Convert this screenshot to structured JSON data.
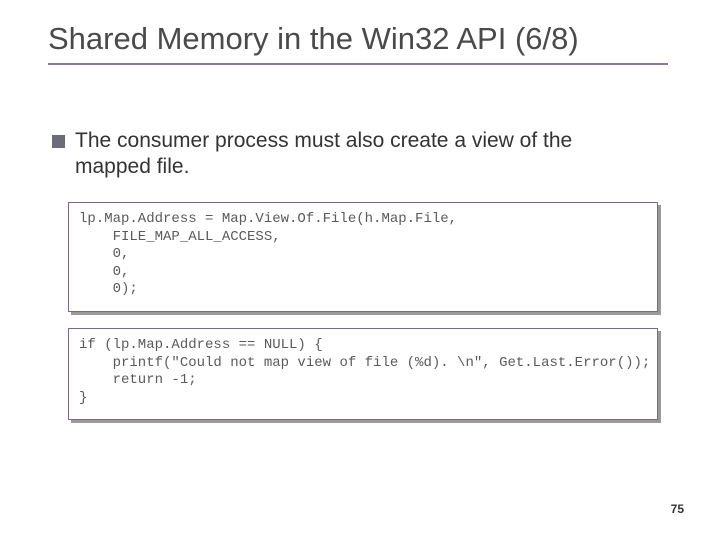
{
  "title": "Shared Memory in the Win32 API (6/8)",
  "bullet": "The consumer process must also create a view of the mapped file.",
  "code1": "lp.Map.Address = Map.View.Of.File(h.Map.File,\n    FILE_MAP_ALL_ACCESS,\n    0,\n    0,\n    0);",
  "code2": "if (lp.Map.Address == NULL) {\n    printf(\"Could not map view of file (%d). \\n\", Get.Last.Error());\n    return -1;\n}",
  "page_number": "75"
}
